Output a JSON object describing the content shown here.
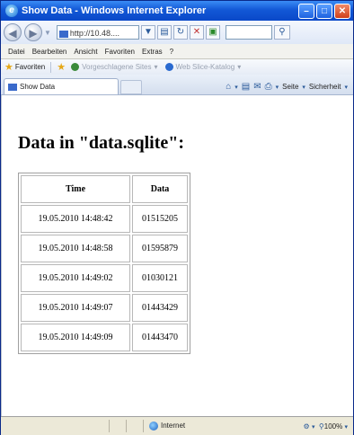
{
  "window": {
    "title": "Show Data - Windows Internet Explorer"
  },
  "address_bar": {
    "url": "http://10.48....",
    "icons": [
      "back-icon",
      "forward-icon",
      "compatibility-icon",
      "refresh-icon",
      "stop-icon",
      "bing-icon"
    ]
  },
  "menu": [
    "Datei",
    "Bearbeiten",
    "Ansicht",
    "Favoriten",
    "Extras",
    "?"
  ],
  "favorites_bar": {
    "label": "Favoriten",
    "suggested": "Vorgeschlagene Sites",
    "slice": "Web Slice-Katalog"
  },
  "tab": {
    "label": "Show Data"
  },
  "toolbar": {
    "page_label": "Seite",
    "safety_label": "Sicherheit"
  },
  "page": {
    "heading": "Data in \"data.sqlite\":",
    "table": {
      "headers": [
        "Time",
        "Data"
      ],
      "rows": [
        [
          "19.05.2010 14:48:42",
          "01515205"
        ],
        [
          "19.05.2010 14:48:58",
          "01595879"
        ],
        [
          "19.05.2010 14:49:02",
          "01030121"
        ],
        [
          "19.05.2010 14:49:07",
          "01443429"
        ],
        [
          "19.05.2010 14:49:09",
          "01443470"
        ]
      ]
    }
  },
  "status_bar": {
    "zone": "Internet",
    "zoom": "100%"
  }
}
